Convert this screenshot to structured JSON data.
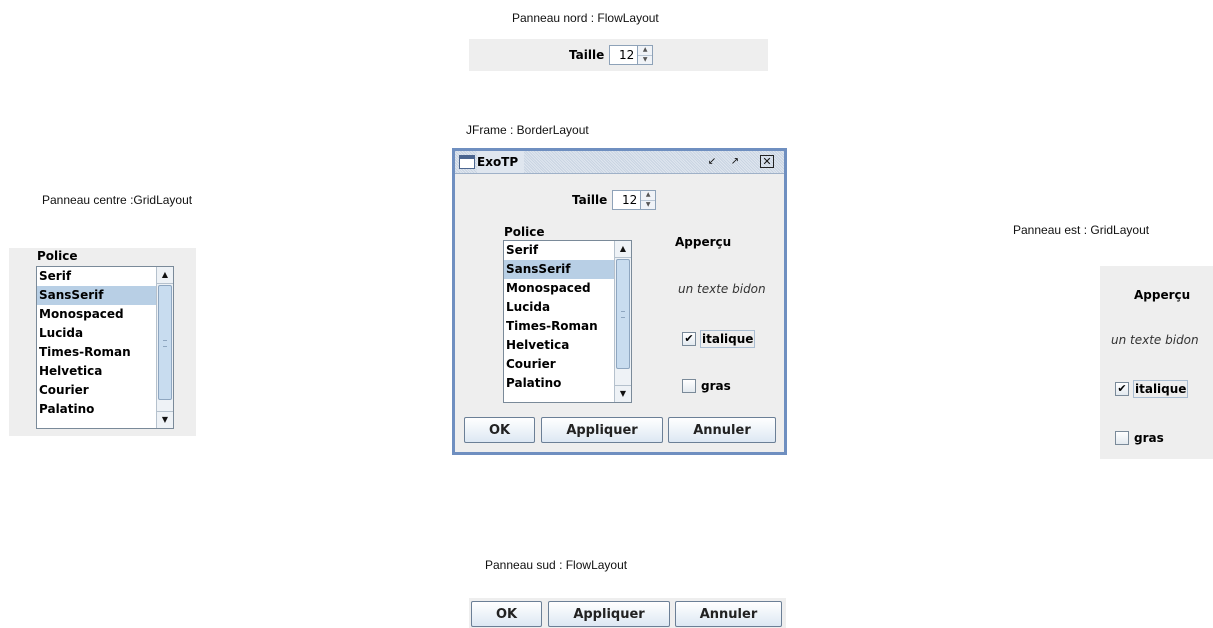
{
  "captions": {
    "nord": "Panneau nord : FlowLayout",
    "jframe": "JFrame : BorderLayout",
    "centre": "Panneau centre :GridLayout",
    "est": "Panneau est : GridLayout",
    "sud": "Panneau sud : FlowLayout"
  },
  "spinner": {
    "label": "Taille",
    "value": "12"
  },
  "font_list": {
    "label": "Police",
    "items": [
      "Serif",
      "SansSerif",
      "Monospaced",
      "Lucida",
      "Times-Roman",
      "Helvetica",
      "Courier",
      "Palatino"
    ],
    "selected": "SansSerif"
  },
  "preview": {
    "title": "Apperçu",
    "sample": "un texte bidon"
  },
  "checkboxes": {
    "italic": {
      "label": "italique",
      "checked": true
    },
    "bold": {
      "label": "gras",
      "checked": false
    }
  },
  "buttons": {
    "ok": "OK",
    "apply": "Appliquer",
    "cancel": "Annuler"
  },
  "window": {
    "title": "ExoTP"
  },
  "icons": {
    "check": "✔",
    "up": "▲",
    "down": "▼"
  }
}
